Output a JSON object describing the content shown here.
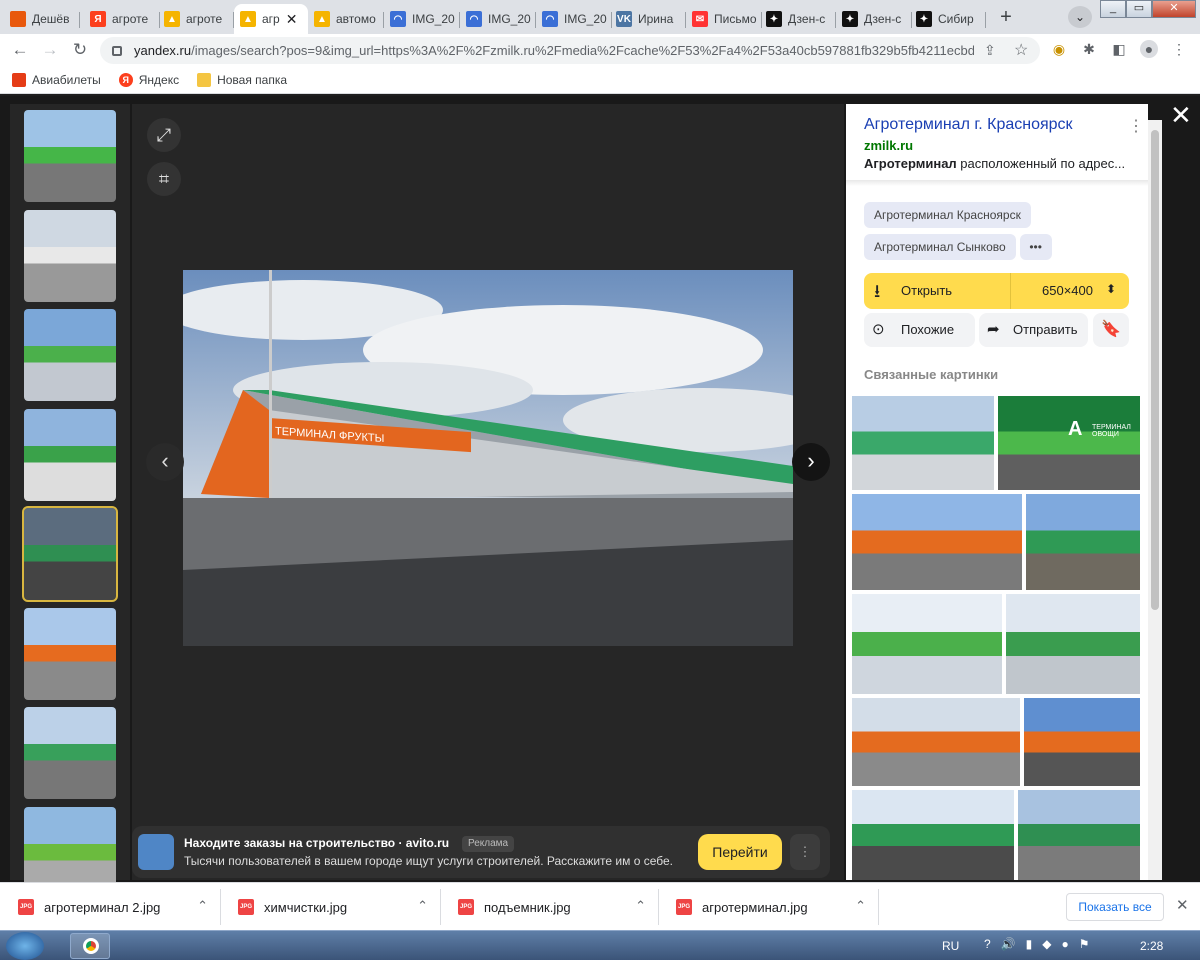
{
  "tabs": [
    {
      "title": "Дешёв",
      "fav": "orange"
    },
    {
      "title": "агроте",
      "fav": "yandex"
    },
    {
      "title": "агроте",
      "fav": "gallery"
    },
    {
      "title": "агр",
      "fav": "gallery",
      "active": true
    },
    {
      "title": "автомо",
      "fav": "gallery"
    },
    {
      "title": "IMG_20",
      "fav": "blue"
    },
    {
      "title": "IMG_20",
      "fav": "blue"
    },
    {
      "title": "IMG_20",
      "fav": "blue"
    },
    {
      "title": "Ирина",
      "fav": "vk"
    },
    {
      "title": "Письмо",
      "fav": "mail"
    },
    {
      "title": "Дзен-с",
      "fav": "dzen"
    },
    {
      "title": "Дзен-с",
      "fav": "dzen"
    },
    {
      "title": "Сибир",
      "fav": "dzen"
    }
  ],
  "address": {
    "host": "yandex.ru",
    "path": "/images/search?pos=9&img_url=https%3A%2F%2Fzmilk.ru%2Fmedia%2Fcache%2F53%2Fa4%2F53a40cb597881fb329b5fb4211ecbdc..."
  },
  "bookmarks": [
    {
      "label": "Авиабилеты"
    },
    {
      "label": "Яндекс"
    },
    {
      "label": "Новая папка"
    }
  ],
  "viewer": {
    "photo_sign": "ТЕРМИНАЛ ФРУКТЫ",
    "panel": {
      "title": "Агротерминал г. Красноярск",
      "source": "zmilk.ru",
      "desc_bold": "Агротерминал",
      "desc_rest": " расположенный по адрес...",
      "tags": [
        "Агротерминал Красноярск",
        "Агротерминал Сынково"
      ],
      "more": "•••",
      "open_label": "Открыть",
      "size_label": "650×400",
      "similar_label": "Похожие",
      "send_label": "Отправить",
      "related_heading": "Связанные картинки",
      "related_sign": "ТЕРМИНАЛ ОВОЩИ",
      "related_letter": "A"
    },
    "ad": {
      "title": "Находите заказы на строительство · avito.ru",
      "badge": "Реклама",
      "text": "Тысячи пользователей в вашем городе ищут услуги строителей. Расскажите им о себе.",
      "button": "Перейти"
    }
  },
  "downloads": {
    "items": [
      "агротерминал 2.jpg",
      "химчистки.jpg",
      "подъемник.jpg",
      "агротерминал.jpg"
    ],
    "show_all": "Показать все"
  },
  "taskbar": {
    "lang": "RU",
    "time": "2:28"
  }
}
